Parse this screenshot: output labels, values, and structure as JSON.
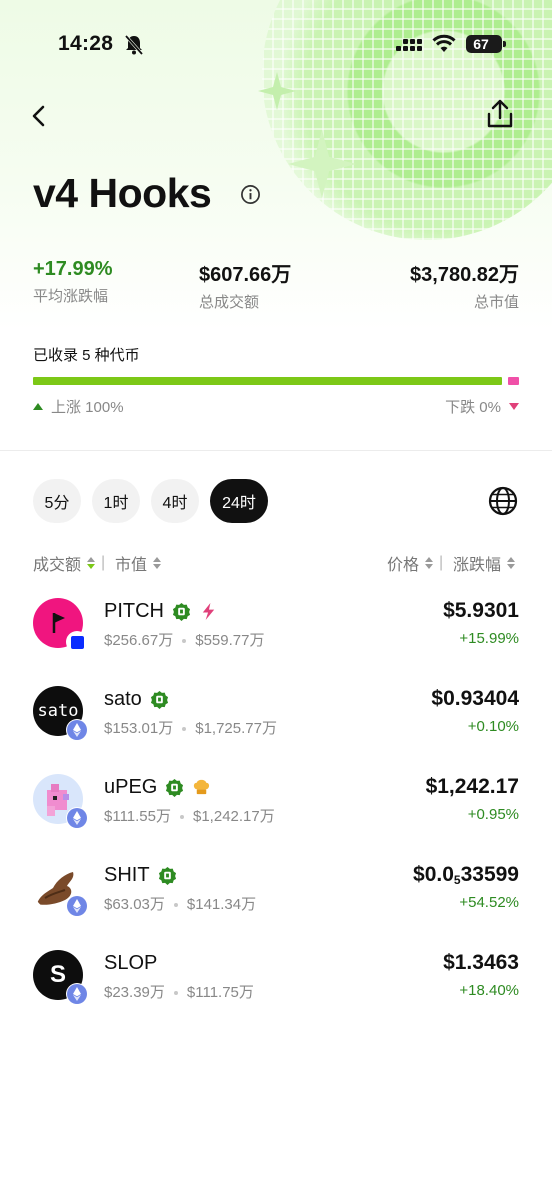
{
  "status_bar": {
    "time": "14:28",
    "battery": "67"
  },
  "header": {
    "title": "v4 Hooks"
  },
  "stats": {
    "avg_change": {
      "value": "+17.99%",
      "label": "平均涨跌幅"
    },
    "volume": {
      "value": "$607.66万",
      "label": "总成交额"
    },
    "market_cap": {
      "value": "$3,780.82万",
      "label": "总市值"
    }
  },
  "distribution": {
    "coins_count_label": "已收录 5 种代币",
    "up_label": "上涨 100%",
    "down_label": "下跌 0%",
    "up_fraction": 1.0,
    "down_fraction": 0.0
  },
  "timeframes": [
    {
      "label": "5分",
      "active": false
    },
    {
      "label": "1时",
      "active": false
    },
    {
      "label": "4时",
      "active": false
    },
    {
      "label": "24时",
      "active": true
    }
  ],
  "sort": {
    "volume": "成交额",
    "market_cap": "市值",
    "price": "价格",
    "change": "涨跌幅"
  },
  "tokens": [
    {
      "name": "PITCH",
      "volume": "$256.67万",
      "market_cap": "$559.77万",
      "price": "$5.9301",
      "change": "+15.99%",
      "avatar_text": "",
      "chain": "base-icon"
    },
    {
      "name": "sato",
      "volume": "$153.01万",
      "market_cap": "$1,725.77万",
      "price": "$0.93404",
      "change": "+0.10%",
      "avatar_text": "sato",
      "chain": "ethereum-icon"
    },
    {
      "name": "uPEG",
      "volume": "$111.55万",
      "market_cap": "$1,242.17万",
      "price": "$1,242.17",
      "change": "+0.95%",
      "avatar_text": "",
      "chain": "ethereum-icon"
    },
    {
      "name": "SHIT",
      "volume": "$63.03万",
      "market_cap": "$141.34万",
      "price_prefix": "$0.0",
      "price_sub": "5",
      "price_rest": "33599",
      "change": "+54.52%",
      "avatar_text": "",
      "chain": "ethereum-icon"
    },
    {
      "name": "SLOP",
      "volume": "$23.39万",
      "market_cap": "$111.75万",
      "price": "$1.3463",
      "change": "+18.40%",
      "avatar_text": "S",
      "chain": "ethereum-icon"
    }
  ],
  "colors": {
    "up": "#2e8b22",
    "bar_up": "#7cc817",
    "bar_down": "#f050a8",
    "active_tab": "#111111"
  }
}
